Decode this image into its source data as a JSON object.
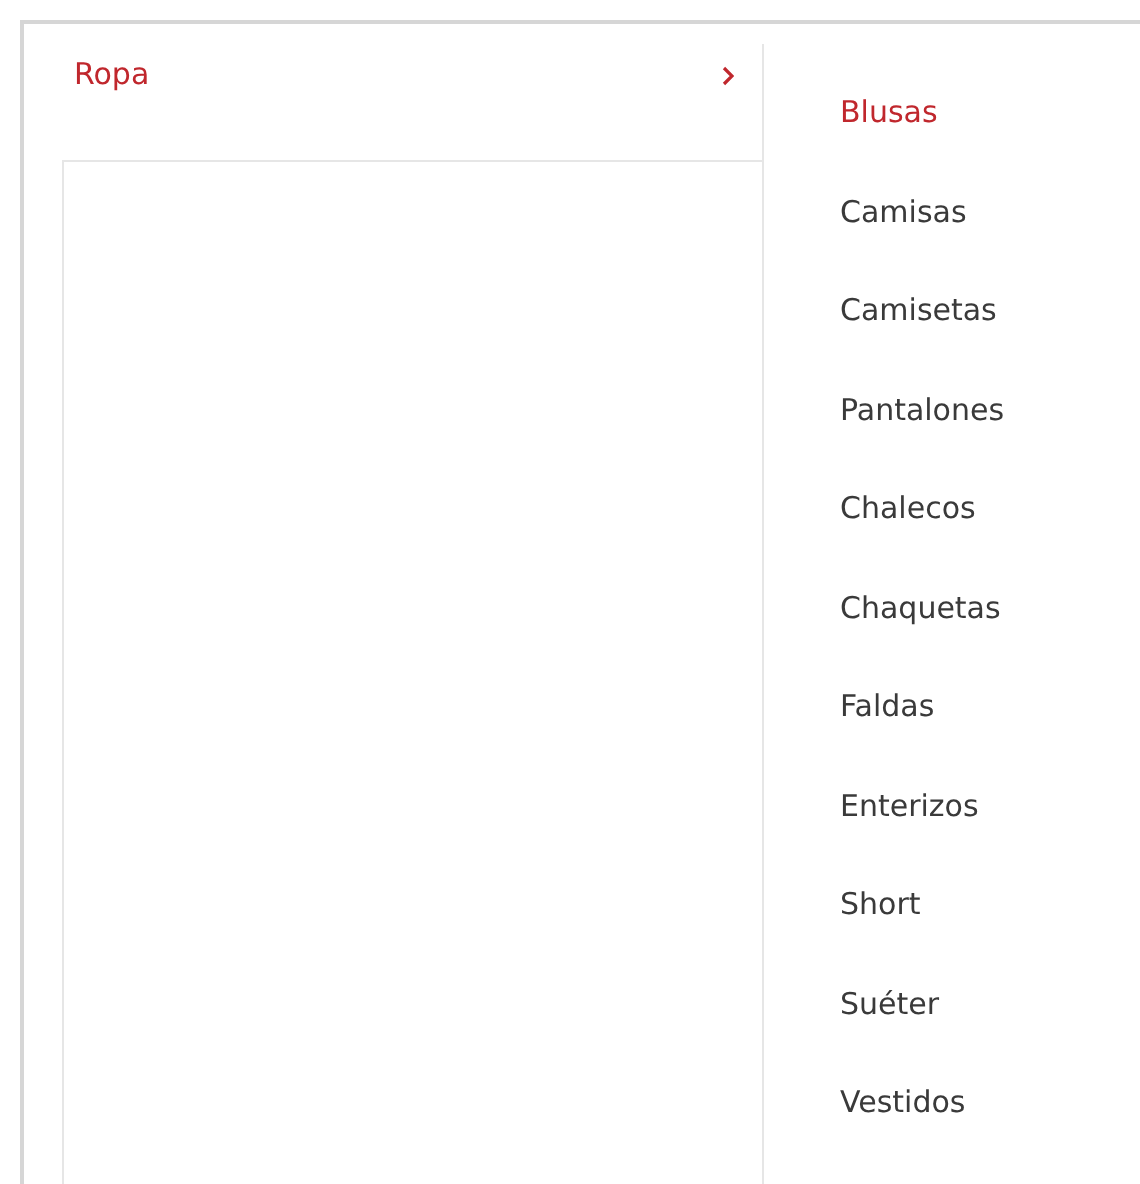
{
  "categories": [
    {
      "label": "Ropa",
      "selected": true
    }
  ],
  "subcategories": [
    {
      "label": "Blusas",
      "selected": true
    },
    {
      "label": "Camisas",
      "selected": false
    },
    {
      "label": "Camisetas",
      "selected": false
    },
    {
      "label": "Pantalones",
      "selected": false
    },
    {
      "label": "Chalecos",
      "selected": false
    },
    {
      "label": "Chaquetas",
      "selected": false
    },
    {
      "label": "Faldas",
      "selected": false
    },
    {
      "label": "Enterizos",
      "selected": false
    },
    {
      "label": "Short",
      "selected": false
    },
    {
      "label": "Suéter",
      "selected": false
    },
    {
      "label": "Vestidos",
      "selected": false
    }
  ]
}
